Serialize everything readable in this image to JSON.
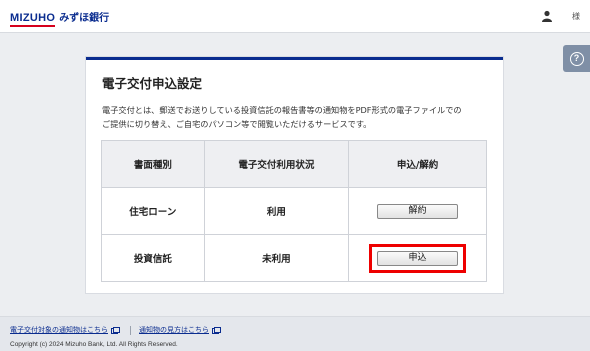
{
  "header": {
    "logo_en": "MIZUHO",
    "logo_jp": "みずほ銀行",
    "user_suffix": "様",
    "user_icon": "user-icon"
  },
  "help": {
    "icon": "help-icon",
    "symbol": "?"
  },
  "card": {
    "title": "電子交付申込設定",
    "description_line1": "電子交付とは、郵送でお送りしている投資信託の報告書等の通知物をPDF形式の電子ファイルでの",
    "description_line2": "ご提供に切り替え、ご自宅のパソコン等で閲覧いただけるサービスです。",
    "table": {
      "headers": [
        "書面種別",
        "電子交付利用状況",
        "申込/解約"
      ],
      "rows": [
        {
          "type": "住宅ローン",
          "status": "利用",
          "action": "解約"
        },
        {
          "type": "投資信託",
          "status": "未利用",
          "action": "申込"
        }
      ]
    }
  },
  "footer": {
    "link1": "電子交付対象の通知物はこちら",
    "link2": "通知物の見方はこちら",
    "copyright": "Copyright (c) 2024 Mizuho Bank, Ltd. All Rights Reserved."
  },
  "colors": {
    "brand_blue": "#0a2c8f",
    "brand_red": "#d6001c",
    "highlight_red": "#ee0000"
  }
}
